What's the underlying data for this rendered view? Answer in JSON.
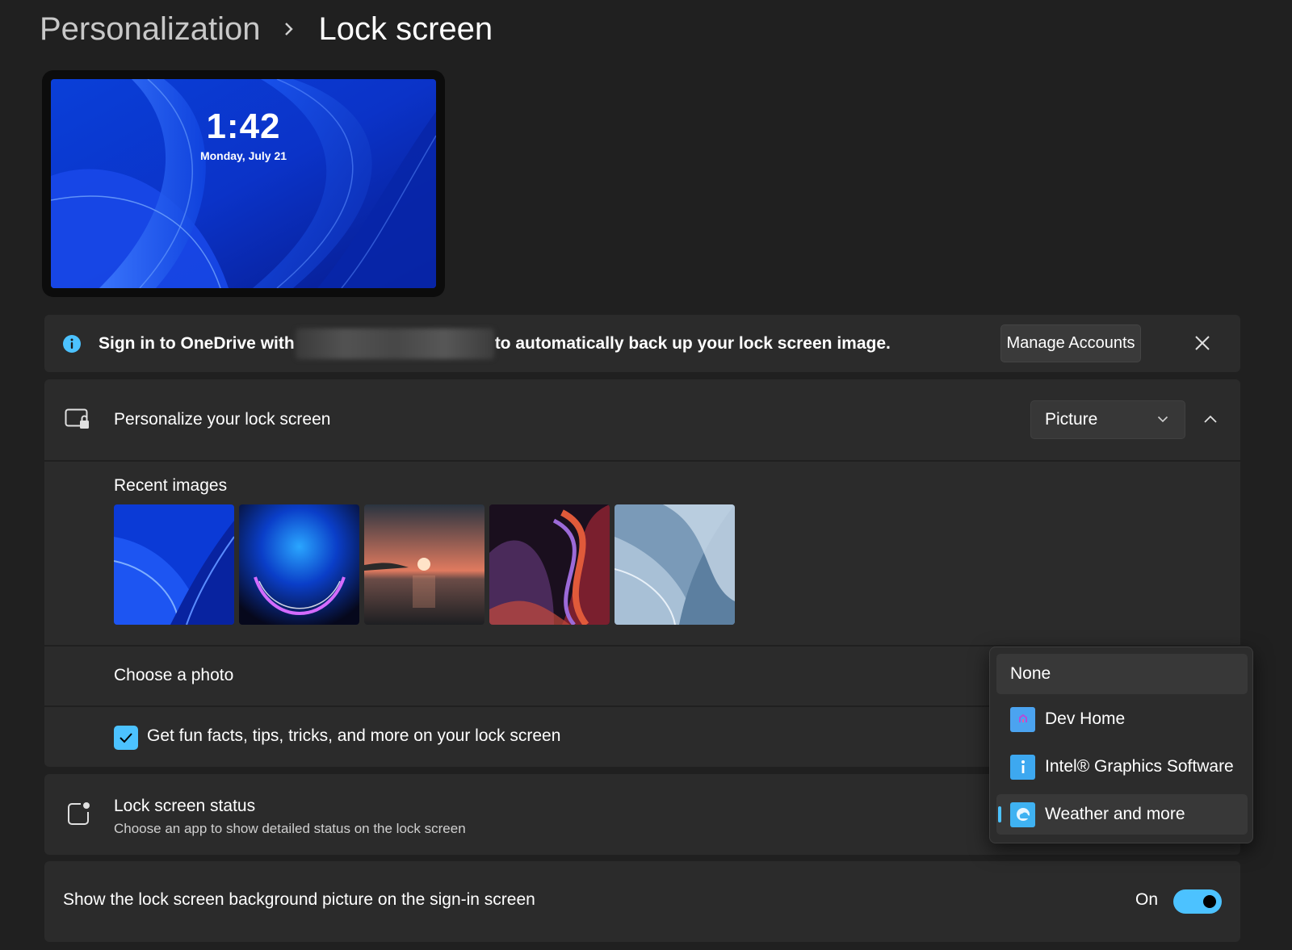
{
  "breadcrumb": {
    "parent": "Personalization",
    "current": "Lock screen"
  },
  "preview": {
    "time": "1:42",
    "date": "Monday, July 21"
  },
  "banner": {
    "text_before": "Sign in to OneDrive with",
    "text_after": "to automatically back up your lock screen image.",
    "manage_button": "Manage Accounts",
    "icons": {
      "info": "info-icon",
      "close": "close-icon"
    },
    "accent": "#4cc2ff"
  },
  "personalize": {
    "label": "Personalize your lock screen",
    "dropdown_value": "Picture",
    "icons": {
      "row": "lock-screen-icon",
      "dropdown": "chevron-down-icon",
      "collapse": "chevron-up-icon"
    }
  },
  "recent": {
    "label": "Recent images",
    "images": [
      "bloom-blue-wallpaper",
      "glow-orb-wallpaper",
      "sunset-lake-wallpaper",
      "ribbon-swirl-wallpaper",
      "bloom-silver-wallpaper"
    ]
  },
  "choose_photo": {
    "label": "Choose a photo"
  },
  "fun_facts": {
    "label": "Get fun facts, tips, tricks, and more on your lock screen",
    "checked": true
  },
  "status": {
    "title": "Lock screen status",
    "subtitle": "Choose an app to show detailed status on the lock screen",
    "icon": "status-icon"
  },
  "signin": {
    "label": "Show the lock screen background picture on the sign-in screen",
    "toggle_label": "On",
    "toggle_on": true
  },
  "flyout": {
    "items": [
      {
        "label": "None",
        "icon": ""
      },
      {
        "label": "Dev Home",
        "icon": "dev-home-icon"
      },
      {
        "label": "Intel® Graphics Software",
        "icon": "intel-info-icon"
      },
      {
        "label": "Weather and more",
        "icon": "weather-icon"
      }
    ],
    "selected_index": 3
  }
}
